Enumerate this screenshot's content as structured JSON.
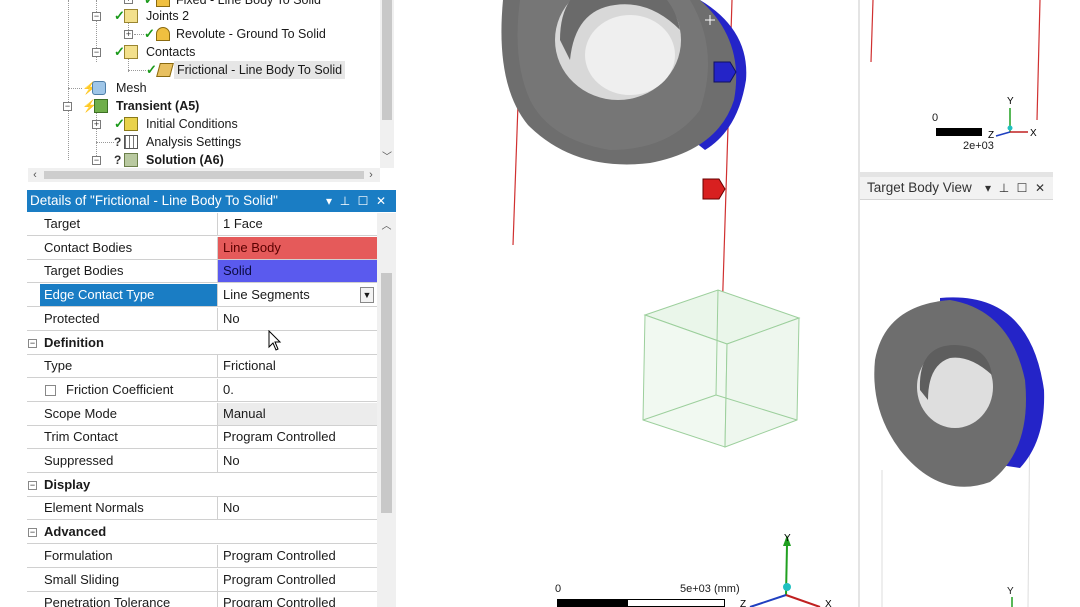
{
  "tree": {
    "items": [
      {
        "label": "Fixed - Line Body To Solid",
        "bold": false
      },
      {
        "label": "Joints 2",
        "bold": false
      },
      {
        "label": "Revolute - Ground To Solid",
        "bold": false
      },
      {
        "label": "Contacts",
        "bold": false
      },
      {
        "label": "Frictional - Line Body To Solid",
        "bold": false
      },
      {
        "label": "Mesh",
        "bold": false
      },
      {
        "label": "Transient (A5)",
        "bold": true
      },
      {
        "label": "Initial Conditions",
        "bold": false
      },
      {
        "label": "Analysis Settings",
        "bold": false
      },
      {
        "label": "Solution (A6)",
        "bold": true
      }
    ]
  },
  "details": {
    "title": "Details of \"Frictional - Line Body To Solid\"",
    "rows": [
      {
        "name": "Target",
        "value": "1 Face",
        "kind": "prop"
      },
      {
        "name": "Contact Bodies",
        "value": "Line Body",
        "kind": "prop",
        "style": "red"
      },
      {
        "name": "Target Bodies",
        "value": "Solid",
        "kind": "prop",
        "style": "blue"
      },
      {
        "name": "Edge Contact Type",
        "value": "Line Segments",
        "kind": "dropdown",
        "selected": true
      },
      {
        "name": "Protected",
        "value": "No",
        "kind": "prop"
      },
      {
        "name": "Definition",
        "value": "",
        "kind": "section"
      },
      {
        "name": "Type",
        "value": "Frictional",
        "kind": "prop"
      },
      {
        "name": "Friction Coefficient",
        "value": "0.",
        "kind": "checkbox"
      },
      {
        "name": "Scope Mode",
        "value": "Manual",
        "kind": "prop",
        "style": "grey"
      },
      {
        "name": "Trim Contact",
        "value": "Program Controlled",
        "kind": "prop"
      },
      {
        "name": "Suppressed",
        "value": "No",
        "kind": "prop"
      },
      {
        "name": "Display",
        "value": "",
        "kind": "section"
      },
      {
        "name": "Element Normals",
        "value": "No",
        "kind": "prop"
      },
      {
        "name": "Advanced",
        "value": "",
        "kind": "section"
      },
      {
        "name": "Formulation",
        "value": "Program Controlled",
        "kind": "prop"
      },
      {
        "name": "Small Sliding",
        "value": "Program Controlled",
        "kind": "prop"
      },
      {
        "name": "Penetration Tolerance",
        "value": "Program Controlled",
        "kind": "prop"
      }
    ]
  },
  "main_view": {
    "scale_zero": "0",
    "scale_value": "5e+03 (mm)",
    "axis_x": "X",
    "axis_y": "Y",
    "axis_z": "Z"
  },
  "top_right_view": {
    "scale_zero": "0",
    "scale_value": "2e+03",
    "axis_x": "X",
    "axis_y": "Y",
    "axis_z": "Z"
  },
  "target_view": {
    "title": "Target Body View",
    "axis_y": "Y"
  },
  "colors": {
    "title_bar": "#1a7dc4",
    "contact_body": "#e55a5a",
    "target_body": "#5a5aee",
    "solid_blue": "#2424c8",
    "solid_grey": "#6e6e6e",
    "line_red": "#d03030"
  },
  "icons": {
    "expand": "plus-box",
    "collapse": "minus-box",
    "valid": "green-check",
    "pin": "pin-icon",
    "close": "close-icon",
    "maximize": "maximize-icon"
  }
}
